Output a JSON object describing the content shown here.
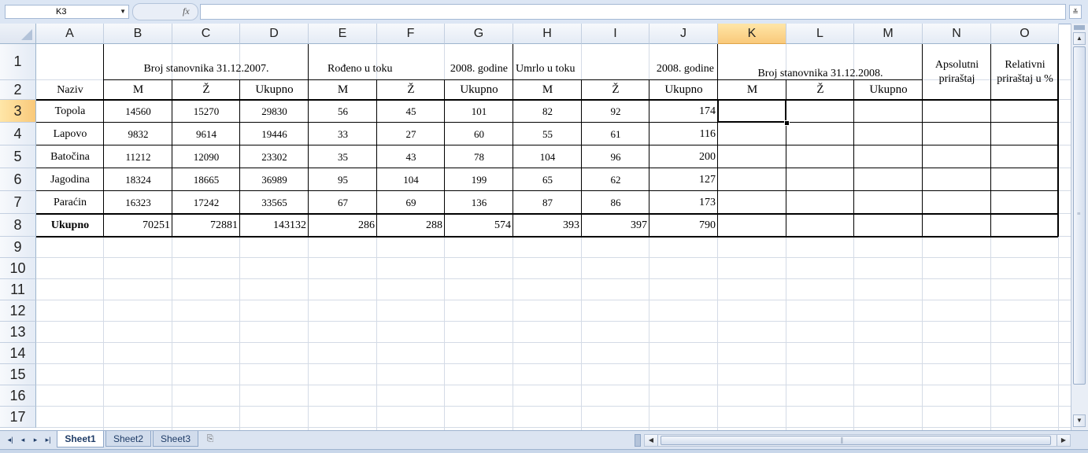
{
  "formula_bar": {
    "name_box": "K3",
    "fx_symbol": "fx",
    "formula": ""
  },
  "columns": [
    "A",
    "B",
    "C",
    "D",
    "E",
    "F",
    "G",
    "H",
    "I",
    "J",
    "K",
    "L",
    "M",
    "N",
    "O"
  ],
  "rows": [
    "1",
    "2",
    "3",
    "4",
    "5",
    "6",
    "7",
    "8",
    "9",
    "10",
    "11",
    "12",
    "13",
    "14",
    "15",
    "16",
    "17"
  ],
  "selected": {
    "column": "K",
    "row": "3"
  },
  "table": {
    "header_groups": {
      "pop_2007": "Broj stanovnika 31.12.2007.",
      "born_left": "Rođeno u toku",
      "born_right": "2008. godine",
      "died_left": "Umrlo u toku",
      "died_right": "2008. godine",
      "pop_2008": "Broj stanovnika 31.12.2008.",
      "abs_growth": "Apsolutni priraštaj",
      "rel_growth": "Relativni priraštaj u %"
    },
    "name_header": "Naziv",
    "sub_headers": [
      "M",
      "Ž",
      "Ukupno",
      "M",
      "Ž",
      "Ukupno",
      "M",
      "Ž",
      "Ukupno",
      "M",
      "Ž",
      "Ukupno"
    ],
    "data_rows": [
      {
        "name": "Topola",
        "values": [
          "14560",
          "15270",
          "29830",
          "56",
          "45",
          "101",
          "82",
          "92",
          "174"
        ]
      },
      {
        "name": "Lapovo",
        "values": [
          "9832",
          "9614",
          "19446",
          "33",
          "27",
          "60",
          "55",
          "61",
          "116"
        ]
      },
      {
        "name": "Batočina",
        "values": [
          "11212",
          "12090",
          "23302",
          "35",
          "43",
          "78",
          "104",
          "96",
          "200"
        ]
      },
      {
        "name": "Jagodina",
        "values": [
          "18324",
          "18665",
          "36989",
          "95",
          "104",
          "199",
          "65",
          "62",
          "127"
        ]
      },
      {
        "name": "Paraćin",
        "values": [
          "16323",
          "17242",
          "33565",
          "67",
          "69",
          "136",
          "87",
          "86",
          "173"
        ]
      }
    ],
    "total_row": {
      "name": "Ukupno",
      "values": [
        "70251",
        "72881",
        "143132",
        "286",
        "288",
        "574",
        "393",
        "397",
        "790"
      ]
    }
  },
  "sheet_tabs": [
    "Sheet1",
    "Sheet2",
    "Sheet3"
  ],
  "active_sheet": "Sheet1",
  "icons": {
    "nav_first": "first-sheet-icon",
    "nav_prev": "prev-sheet-icon",
    "nav_next": "next-sheet-icon",
    "nav_last": "last-sheet-icon",
    "new_sheet": "insert-worksheet-icon"
  }
}
